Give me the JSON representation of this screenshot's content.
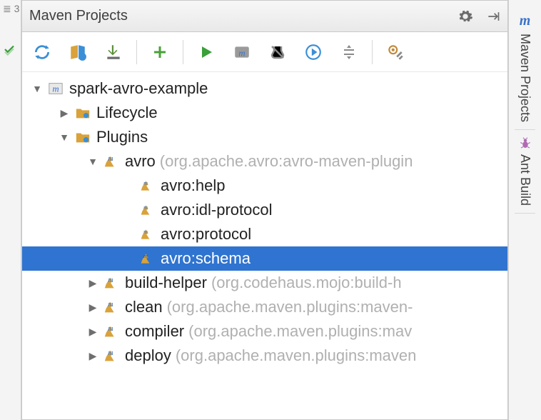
{
  "gutter": {
    "marker_lines": "≣ 3"
  },
  "panel": {
    "title": "Maven Projects",
    "toolbar": {
      "refresh": "Refresh",
      "generate_sources": "Generate Sources",
      "download": "Download",
      "add": "Add",
      "run": "Run",
      "run_config": "Run Configuration",
      "toggle_skip_tests": "Toggle Skip Tests",
      "offline": "Offline Mode",
      "collapse": "Collapse All",
      "settings": "Settings"
    }
  },
  "tree": {
    "project": "spark-avro-example",
    "lifecycle": "Lifecycle",
    "plugins_label": "Plugins",
    "plugins": [
      {
        "name": "avro",
        "suffix": "(org.apache.avro:avro-maven-plugin",
        "expanded": true,
        "goals": [
          "avro:help",
          "avro:idl-protocol",
          "avro:protocol",
          "avro:schema"
        ],
        "selected_goal": "avro:schema"
      },
      {
        "name": "build-helper",
        "suffix": "(org.codehaus.mojo:build-h"
      },
      {
        "name": "clean",
        "suffix": "(org.apache.maven.plugins:maven-"
      },
      {
        "name": "compiler",
        "suffix": "(org.apache.maven.plugins:mav"
      },
      {
        "name": "deploy",
        "suffix": "(org.apache.maven.plugins:maven"
      }
    ]
  },
  "dock": {
    "maven": "Maven Projects",
    "ant": "Ant Build"
  }
}
